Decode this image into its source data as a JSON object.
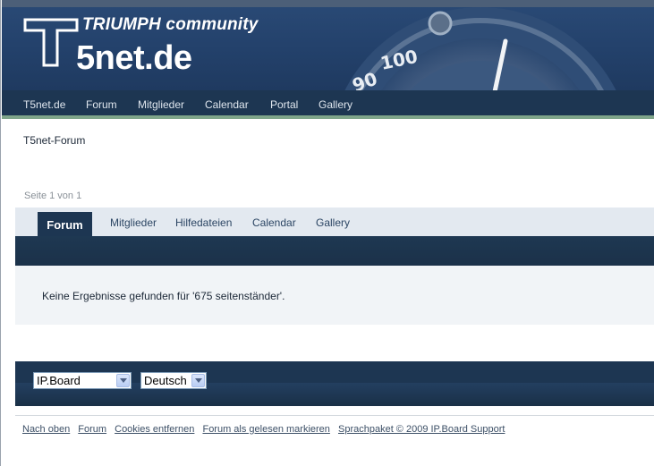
{
  "header": {
    "logo_letter": "T",
    "logo_community": "TRIUMPH community",
    "logo_site": "5net.de",
    "gauge_labels": [
      "100",
      "90"
    ]
  },
  "primary_nav": {
    "items": [
      {
        "label": "T5net.de"
      },
      {
        "label": "Forum"
      },
      {
        "label": "Mitglieder"
      },
      {
        "label": "Calendar"
      },
      {
        "label": "Portal"
      },
      {
        "label": "Gallery"
      }
    ]
  },
  "breadcrumb": "T5net-Forum",
  "pagination": "Seite 1 von 1",
  "tabs": {
    "active": "Forum",
    "items": [
      {
        "label": "Mitglieder"
      },
      {
        "label": "Hilfedateien"
      },
      {
        "label": "Calendar"
      },
      {
        "label": "Gallery"
      }
    ]
  },
  "message": "Keine Ergebnisse gefunden für '675 seitenständer'.",
  "footer": {
    "skin_select": "IP.Board",
    "language_select": "Deutsch",
    "links": [
      {
        "label": "Nach oben"
      },
      {
        "label": "Forum"
      },
      {
        "label": "Cookies entfernen"
      },
      {
        "label": "Forum als gelesen markieren"
      },
      {
        "label": "Sprachpaket © 2009 IP.Board Support"
      }
    ]
  },
  "colors": {
    "banner": "#23416b",
    "nav": "#1d3652",
    "accent_line": "#7fa58a",
    "tabbar": "#e3e9f0"
  }
}
